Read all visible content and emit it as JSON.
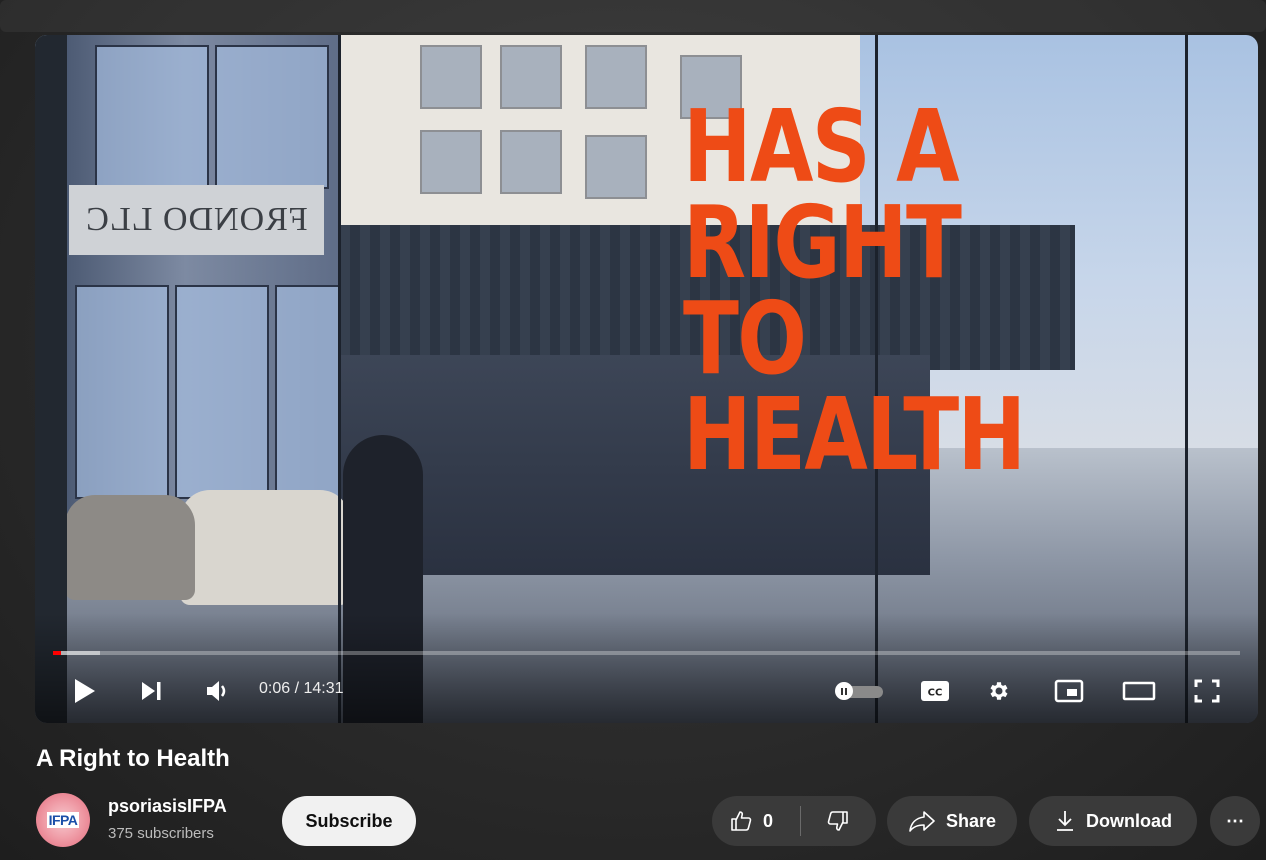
{
  "video": {
    "overlay_lines": [
      "HAS A",
      "RIGHT",
      "TO",
      "HEALTH"
    ],
    "sign_text": "FRONDO LLC",
    "title": "A Right to Health"
  },
  "player": {
    "time_display": "0:06 / 14:31",
    "current_time": "0:06",
    "duration": "14:31",
    "progress_fraction": 0.007,
    "buffered_fraction": 0.04,
    "progress_color": "#ff0000",
    "controls": {
      "play": "play-icon",
      "next": "next-icon",
      "volume": "volume-icon",
      "autoplay": "autoplay-toggle",
      "captions": "cc-icon",
      "settings": "gear-icon",
      "miniplayer": "miniplayer-icon",
      "theater": "theater-icon",
      "fullscreen": "fullscreen-icon"
    }
  },
  "channel": {
    "name": "psoriasisIFPA",
    "subscribers": "375 subscribers",
    "avatar_text": "IFPA"
  },
  "actions": {
    "subscribe_label": "Subscribe",
    "like_count": "0",
    "share_label": "Share",
    "download_label": "Download",
    "more_label": "⋯"
  }
}
